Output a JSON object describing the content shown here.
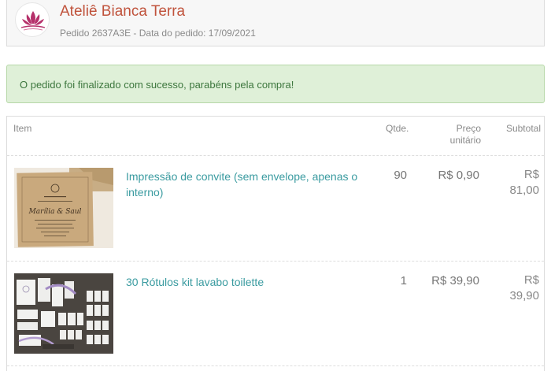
{
  "store": {
    "name": "Ateliê Bianca Terra",
    "order_line": "Pedido 2637A3E - Data do pedido: 17/09/2021",
    "logo_icon": "lotus-logo-icon",
    "accent_color": "#c0533c"
  },
  "alert": {
    "message": "O pedido foi finalizado com sucesso, parabéns pela compra!",
    "color": "#dff0d8"
  },
  "table": {
    "headers": {
      "item": "Item",
      "qty": "Qtde.",
      "price": "Preço unitário",
      "subtotal": "Subtotal"
    },
    "rows": [
      {
        "name": "Impressão de convite (sem envelope, apenas o interno)",
        "qty": "90",
        "price": "R$ 0,90",
        "subtotal": "R$ 81,00",
        "thumb": "kraft-invitation-image"
      },
      {
        "name": "30 Rótulos kit lavabo toilette",
        "qty": "1",
        "price": "R$ 39,90",
        "subtotal": "R$ 39,90",
        "thumb": "toilette-labels-image"
      }
    ]
  }
}
